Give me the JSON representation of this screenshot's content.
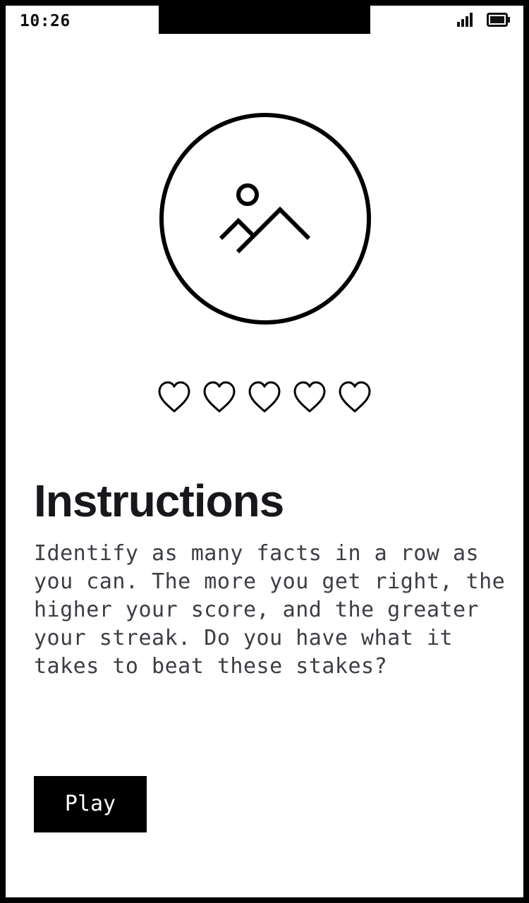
{
  "status_bar": {
    "time": "10:26",
    "signal_icon": "cellular-signal-icon",
    "battery_icon": "battery-full-icon"
  },
  "hero": {
    "icon": "image-placeholder-icon"
  },
  "lives": {
    "count": 5,
    "filled": 0,
    "icon": "heart-outline-icon"
  },
  "content": {
    "title": "Instructions",
    "body": "Identify as many facts in a row as you can. The more you get right, the higher your score, and the greater your streak. Do you have what it takes to beat these stakes?"
  },
  "actions": {
    "play_label": "Play"
  },
  "colors": {
    "background": "#ffffff",
    "frame": "#000000",
    "title": "#17171c",
    "body": "#3d3d45",
    "button_bg": "#000000",
    "button_text": "#ffffff"
  }
}
